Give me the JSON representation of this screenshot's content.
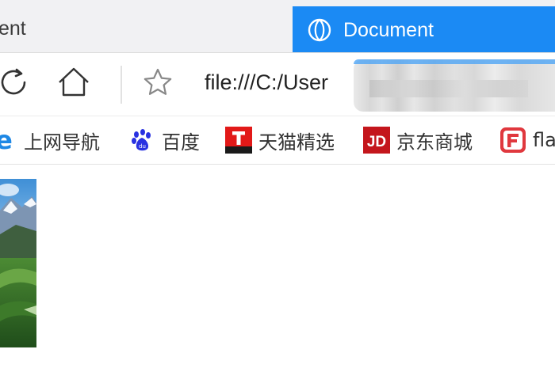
{
  "tabs": [
    {
      "title": "ent",
      "active": false
    },
    {
      "title": "Document",
      "active": true
    }
  ],
  "navigation": {
    "icons": [
      "refresh-icon",
      "home-icon",
      "favorite-star-icon"
    ],
    "address": "file:///C:/User"
  },
  "bookmarks": [
    {
      "label": "上网导航",
      "icon": "ie-icon"
    },
    {
      "label": "百度",
      "icon": "baidu-paw-icon"
    },
    {
      "label": "天猫精选",
      "icon": "tmall-icon"
    },
    {
      "label": "京东商城",
      "icon": "jd-icon"
    },
    {
      "label": "fla",
      "icon": "flash-f-icon"
    }
  ],
  "colors": {
    "active_tab": "#1b8af4",
    "tabstrip": "#f1f1f3",
    "jd_red": "#c4161c",
    "tmall_red": "#e21918",
    "baidu_blue": "#2932e1",
    "flash_red": "#e0383e",
    "ie_blue": "#1e88e5"
  }
}
